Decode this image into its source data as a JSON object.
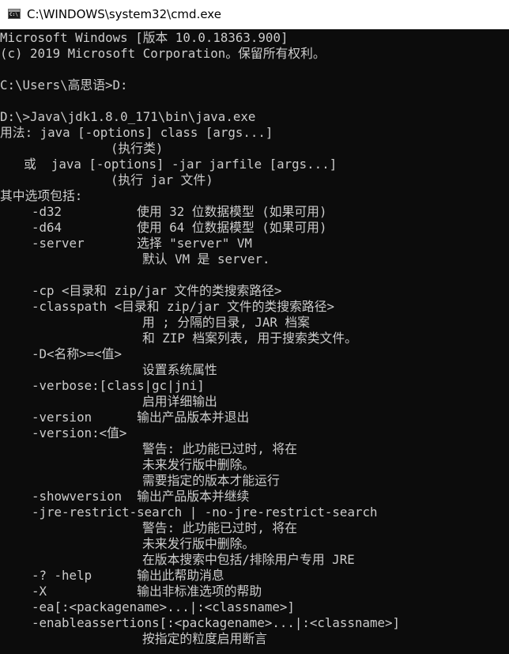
{
  "window": {
    "title": "C:\\WINDOWS\\system32\\cmd.exe",
    "icon": "cmd-app-icon",
    "icon_text": "C:\\",
    "colors": {
      "titlebar_bg": "#ffffff",
      "console_bg": "#0c0c0c",
      "console_fg": "#cccccc"
    }
  },
  "console": {
    "lines": [
      {
        "indent": 0,
        "text": "Microsoft Windows [版本 10.0.18363.900]"
      },
      {
        "indent": 0,
        "text": "(c) 2019 Microsoft Corporation。保留所有权利。"
      },
      {
        "indent": 0,
        "text": ""
      },
      {
        "indent": 0,
        "text": "C:\\Users\\高思语>D:"
      },
      {
        "indent": 0,
        "text": ""
      },
      {
        "indent": 0,
        "text": "D:\\>Java\\jdk1.8.0_171\\bin\\java.exe"
      },
      {
        "indent": 0,
        "text": "用法: java [-options] class [args...]"
      },
      {
        "indent": 14,
        "text": "(执行类)"
      },
      {
        "indent": 3,
        "text": "或  java [-options] -jar jarfile [args...]"
      },
      {
        "indent": 14,
        "text": "(执行 jar 文件)"
      },
      {
        "indent": 0,
        "text": "其中选项包括:"
      },
      {
        "indent": 4,
        "text": "-d32          使用 32 位数据模型 (如果可用)"
      },
      {
        "indent": 4,
        "text": "-d64          使用 64 位数据模型 (如果可用)"
      },
      {
        "indent": 4,
        "text": "-server       选择 \"server\" VM"
      },
      {
        "indent": 18,
        "text": "默认 VM 是 server."
      },
      {
        "indent": 0,
        "text": ""
      },
      {
        "indent": 4,
        "text": "-cp <目录和 zip/jar 文件的类搜索路径>"
      },
      {
        "indent": 4,
        "text": "-classpath <目录和 zip/jar 文件的类搜索路径>"
      },
      {
        "indent": 18,
        "text": "用 ; 分隔的目录, JAR 档案"
      },
      {
        "indent": 18,
        "text": "和 ZIP 档案列表, 用于搜索类文件。"
      },
      {
        "indent": 4,
        "text": "-D<名称>=<值>"
      },
      {
        "indent": 18,
        "text": "设置系统属性"
      },
      {
        "indent": 4,
        "text": "-verbose:[class|gc|jni]"
      },
      {
        "indent": 18,
        "text": "启用详细输出"
      },
      {
        "indent": 4,
        "text": "-version      输出产品版本并退出"
      },
      {
        "indent": 4,
        "text": "-version:<值>"
      },
      {
        "indent": 18,
        "text": "警告: 此功能已过时, 将在"
      },
      {
        "indent": 18,
        "text": "未来发行版中删除。"
      },
      {
        "indent": 18,
        "text": "需要指定的版本才能运行"
      },
      {
        "indent": 4,
        "text": "-showversion  输出产品版本并继续"
      },
      {
        "indent": 4,
        "text": "-jre-restrict-search | -no-jre-restrict-search"
      },
      {
        "indent": 18,
        "text": "警告: 此功能已过时, 将在"
      },
      {
        "indent": 18,
        "text": "未来发行版中删除。"
      },
      {
        "indent": 18,
        "text": "在版本搜索中包括/排除用户专用 JRE"
      },
      {
        "indent": 4,
        "text": "-? -help      输出此帮助消息"
      },
      {
        "indent": 4,
        "text": "-X            输出非标准选项的帮助"
      },
      {
        "indent": 4,
        "text": "-ea[:<packagename>...|:<classname>]"
      },
      {
        "indent": 4,
        "text": "-enableassertions[:<packagename>...|:<classname>]"
      },
      {
        "indent": 18,
        "text": "按指定的粒度启用断言"
      }
    ]
  }
}
